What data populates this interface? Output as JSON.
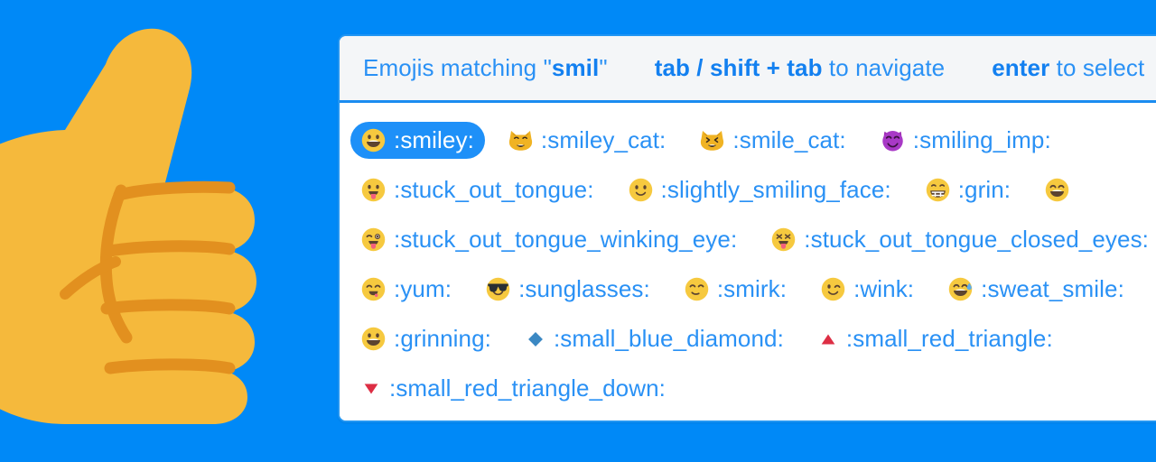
{
  "background": {
    "color": "#0089f7",
    "artwork": "thumbs-up-emoji"
  },
  "panel": {
    "border_color": "#2196f3",
    "header_background": "#f4f6f8",
    "body_background": "#ffffff",
    "accent_color": "#2a91f5",
    "selected_background": "#1e90f8",
    "header": {
      "match_prefix": "Emojis matching ",
      "quote_open": "\"",
      "query": "smil",
      "quote_close": "\"",
      "nav_keys": "tab / shift + tab",
      "nav_text": " to navigate",
      "select_key": "enter",
      "select_text": " to select"
    },
    "rows": [
      {
        "items": [
          {
            "glyph": "smiley",
            "label": ":smiley:",
            "selected": true
          },
          {
            "glyph": "smiley_cat",
            "label": ":smiley_cat:",
            "selected": false
          },
          {
            "glyph": "smile_cat",
            "label": ":smile_cat:",
            "selected": false
          },
          {
            "glyph": "smiling_imp",
            "label": ":smiling_imp:",
            "selected": false
          }
        ]
      },
      {
        "items": [
          {
            "glyph": "stuck_out_tongue",
            "label": ":stuck_out_tongue:",
            "selected": false
          },
          {
            "glyph": "slightly_smiling_face",
            "label": ":slightly_smiling_face:",
            "selected": false
          },
          {
            "glyph": "grin",
            "label": ":grin:",
            "selected": false
          },
          {
            "glyph": "smile",
            "label": "",
            "selected": false
          }
        ]
      },
      {
        "items": [
          {
            "glyph": "stuck_out_tongue_winking_eye",
            "label": ":stuck_out_tongue_winking_eye:",
            "selected": false
          },
          {
            "glyph": "stuck_out_tongue_closed_eyes",
            "label": ":stuck_out_tongue_closed_eyes:",
            "selected": false
          }
        ]
      },
      {
        "items": [
          {
            "glyph": "yum",
            "label": ":yum:",
            "selected": false
          },
          {
            "glyph": "sunglasses",
            "label": ":sunglasses:",
            "selected": false
          },
          {
            "glyph": "smirk",
            "label": ":smirk:",
            "selected": false
          },
          {
            "glyph": "wink",
            "label": ":wink:",
            "selected": false
          },
          {
            "glyph": "sweat_smile",
            "label": ":sweat_smile:",
            "selected": false
          }
        ]
      },
      {
        "items": [
          {
            "glyph": "grinning",
            "label": ":grinning:",
            "selected": false
          },
          {
            "glyph": "small_blue_diamond",
            "label": ":small_blue_diamond:",
            "selected": false
          },
          {
            "glyph": "small_red_triangle",
            "label": ":small_red_triangle:",
            "selected": false
          }
        ]
      },
      {
        "items": [
          {
            "glyph": "small_red_triangle_down",
            "label": ":small_red_triangle_down:",
            "selected": false
          }
        ]
      }
    ]
  }
}
